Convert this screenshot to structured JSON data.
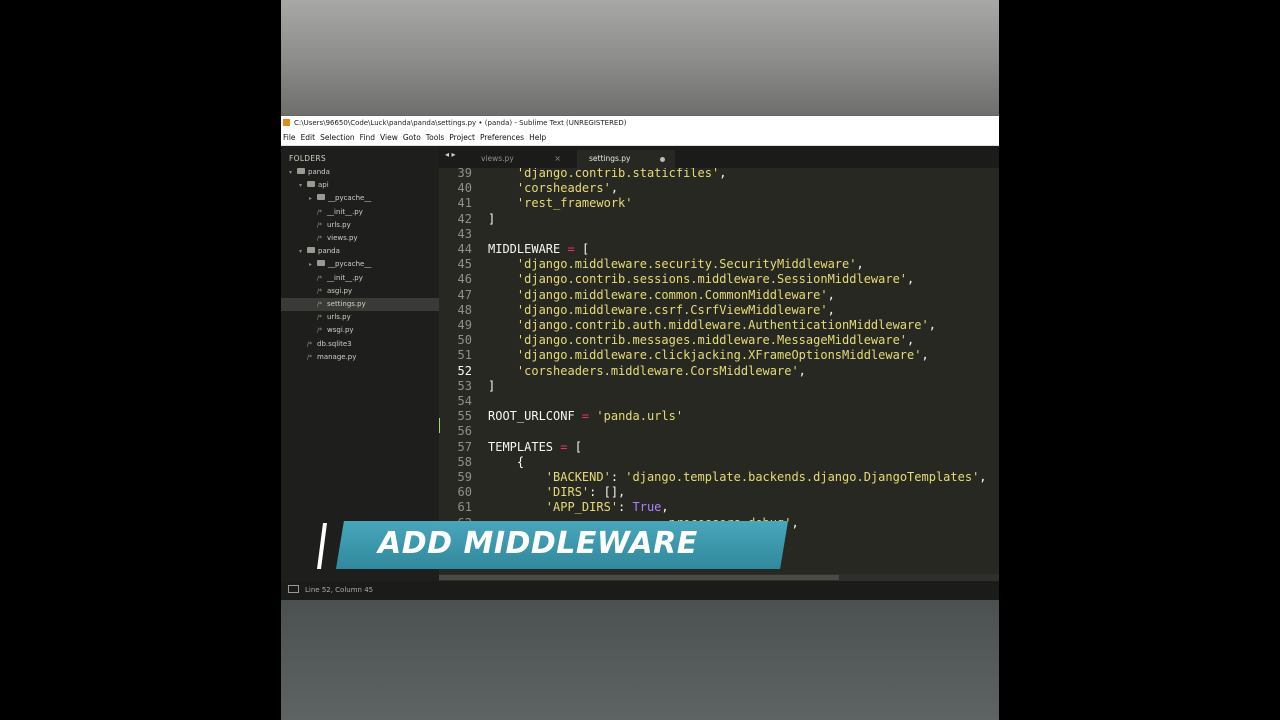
{
  "window": {
    "title": "C:\\Users\\96650\\Code\\Luck\\panda\\panda\\settings.py • (panda) - Sublime Text (UNREGISTERED)"
  },
  "menu": [
    "File",
    "Edit",
    "Selection",
    "Find",
    "View",
    "Goto",
    "Tools",
    "Project",
    "Preferences",
    "Help"
  ],
  "sidebar": {
    "header": "FOLDERS",
    "items": [
      {
        "label": "panda",
        "type": "folder",
        "level": 0
      },
      {
        "label": "api",
        "type": "folder",
        "level": 1
      },
      {
        "label": "__pycache__",
        "type": "folder",
        "level": 2
      },
      {
        "label": "__init__.py",
        "type": "file",
        "level": 2
      },
      {
        "label": "urls.py",
        "type": "file",
        "level": 2
      },
      {
        "label": "views.py",
        "type": "file",
        "level": 2
      },
      {
        "label": "panda",
        "type": "folder",
        "level": 1
      },
      {
        "label": "__pycache__",
        "type": "folder",
        "level": 2
      },
      {
        "label": "__init__.py",
        "type": "file",
        "level": 2
      },
      {
        "label": "asgi.py",
        "type": "file",
        "level": 2
      },
      {
        "label": "settings.py",
        "type": "file",
        "level": 2,
        "selected": true
      },
      {
        "label": "urls.py",
        "type": "file",
        "level": 2
      },
      {
        "label": "wsgi.py",
        "type": "file",
        "level": 2
      },
      {
        "label": "db.sqlite3",
        "type": "file",
        "level": 1
      },
      {
        "label": "manage.py",
        "type": "file",
        "level": 1
      }
    ]
  },
  "tabs": {
    "nav": "◂ ▸",
    "items": [
      {
        "label": "views.py",
        "active": false,
        "close": "×"
      },
      {
        "label": "settings.py",
        "active": true,
        "dirty": true
      }
    ]
  },
  "editor": {
    "current_line": 52,
    "lines": [
      {
        "n": "39",
        "tokens": [
          [
            "p",
            "    "
          ],
          [
            "s",
            "'django.contrib.staticfiles'"
          ],
          [
            "p",
            ",",
            ""
          ]
        ]
      },
      {
        "n": "40",
        "tokens": [
          [
            "p",
            "    "
          ],
          [
            "s",
            "'corsheaders'"
          ],
          [
            "p",
            ","
          ]
        ]
      },
      {
        "n": "41",
        "tokens": [
          [
            "p",
            "    "
          ],
          [
            "s",
            "'rest_framework'"
          ]
        ]
      },
      {
        "n": "42",
        "tokens": [
          [
            "p",
            "]"
          ]
        ]
      },
      {
        "n": "43",
        "tokens": []
      },
      {
        "n": "44",
        "tokens": [
          [
            "p",
            "MIDDLEWARE "
          ],
          [
            "o",
            "="
          ],
          [
            "p",
            " ["
          ]
        ]
      },
      {
        "n": "45",
        "tokens": [
          [
            "p",
            "    "
          ],
          [
            "s",
            "'django.middleware.security.SecurityMiddleware'"
          ],
          [
            "p",
            ","
          ]
        ]
      },
      {
        "n": "46",
        "tokens": [
          [
            "p",
            "    "
          ],
          [
            "s",
            "'django.contrib.sessions.middleware.SessionMiddleware'"
          ],
          [
            "p",
            ","
          ]
        ]
      },
      {
        "n": "47",
        "tokens": [
          [
            "p",
            "    "
          ],
          [
            "s",
            "'django.middleware.common.CommonMiddleware'"
          ],
          [
            "p",
            ","
          ]
        ]
      },
      {
        "n": "48",
        "tokens": [
          [
            "p",
            "    "
          ],
          [
            "s",
            "'django.middleware.csrf.CsrfViewMiddleware'"
          ],
          [
            "p",
            ","
          ]
        ]
      },
      {
        "n": "49",
        "tokens": [
          [
            "p",
            "    "
          ],
          [
            "s",
            "'django.contrib.auth.middleware.AuthenticationMiddleware'"
          ],
          [
            "p",
            ","
          ]
        ]
      },
      {
        "n": "50",
        "tokens": [
          [
            "p",
            "    "
          ],
          [
            "s",
            "'django.contrib.messages.middleware.MessageMiddleware'"
          ],
          [
            "p",
            ","
          ]
        ]
      },
      {
        "n": "51",
        "tokens": [
          [
            "p",
            "    "
          ],
          [
            "s",
            "'django.middleware.clickjacking.XFrameOptionsMiddleware'"
          ],
          [
            "p",
            ","
          ]
        ]
      },
      {
        "n": "52",
        "tokens": [
          [
            "p",
            "    "
          ],
          [
            "s",
            "'corsheaders.middleware.CorsMiddleware'"
          ],
          [
            "p",
            ","
          ]
        ]
      },
      {
        "n": "53",
        "tokens": [
          [
            "p",
            "]"
          ]
        ]
      },
      {
        "n": "54",
        "tokens": []
      },
      {
        "n": "55",
        "tokens": [
          [
            "p",
            "ROOT_URLCONF "
          ],
          [
            "o",
            "="
          ],
          [
            "p",
            " "
          ],
          [
            "s",
            "'panda.urls'"
          ]
        ]
      },
      {
        "n": "56",
        "tokens": []
      },
      {
        "n": "57",
        "tokens": [
          [
            "p",
            "TEMPLATES "
          ],
          [
            "o",
            "="
          ],
          [
            "p",
            " ["
          ]
        ]
      },
      {
        "n": "58",
        "tokens": [
          [
            "p",
            "    {"
          ]
        ]
      },
      {
        "n": "59",
        "tokens": [
          [
            "p",
            "        "
          ],
          [
            "s",
            "'BACKEND'"
          ],
          [
            "p",
            ": "
          ],
          [
            "s",
            "'django.template.backends.django.DjangoTemplates'"
          ],
          [
            "p",
            ","
          ]
        ]
      },
      {
        "n": "60",
        "tokens": [
          [
            "p",
            "        "
          ],
          [
            "s",
            "'DIRS'"
          ],
          [
            "p",
            ": [],"
          ]
        ]
      },
      {
        "n": "61",
        "tokens": [
          [
            "p",
            "        "
          ],
          [
            "s",
            "'APP_DIRS'"
          ],
          [
            "p",
            ": "
          ],
          [
            "k",
            "True"
          ],
          [
            "p",
            ","
          ]
        ]
      },
      {
        "n": "62",
        "tokens": [
          [
            "p",
            "                        "
          ],
          [
            "s",
            "_processors.debug'"
          ],
          [
            "p",
            ","
          ]
        ]
      },
      {
        "n": "",
        "tokens": []
      }
    ]
  },
  "status": {
    "position": "Line 52, Column 45"
  },
  "overlay": {
    "banner_text": "ADD MIDDLEWARE",
    "slash": "/"
  }
}
